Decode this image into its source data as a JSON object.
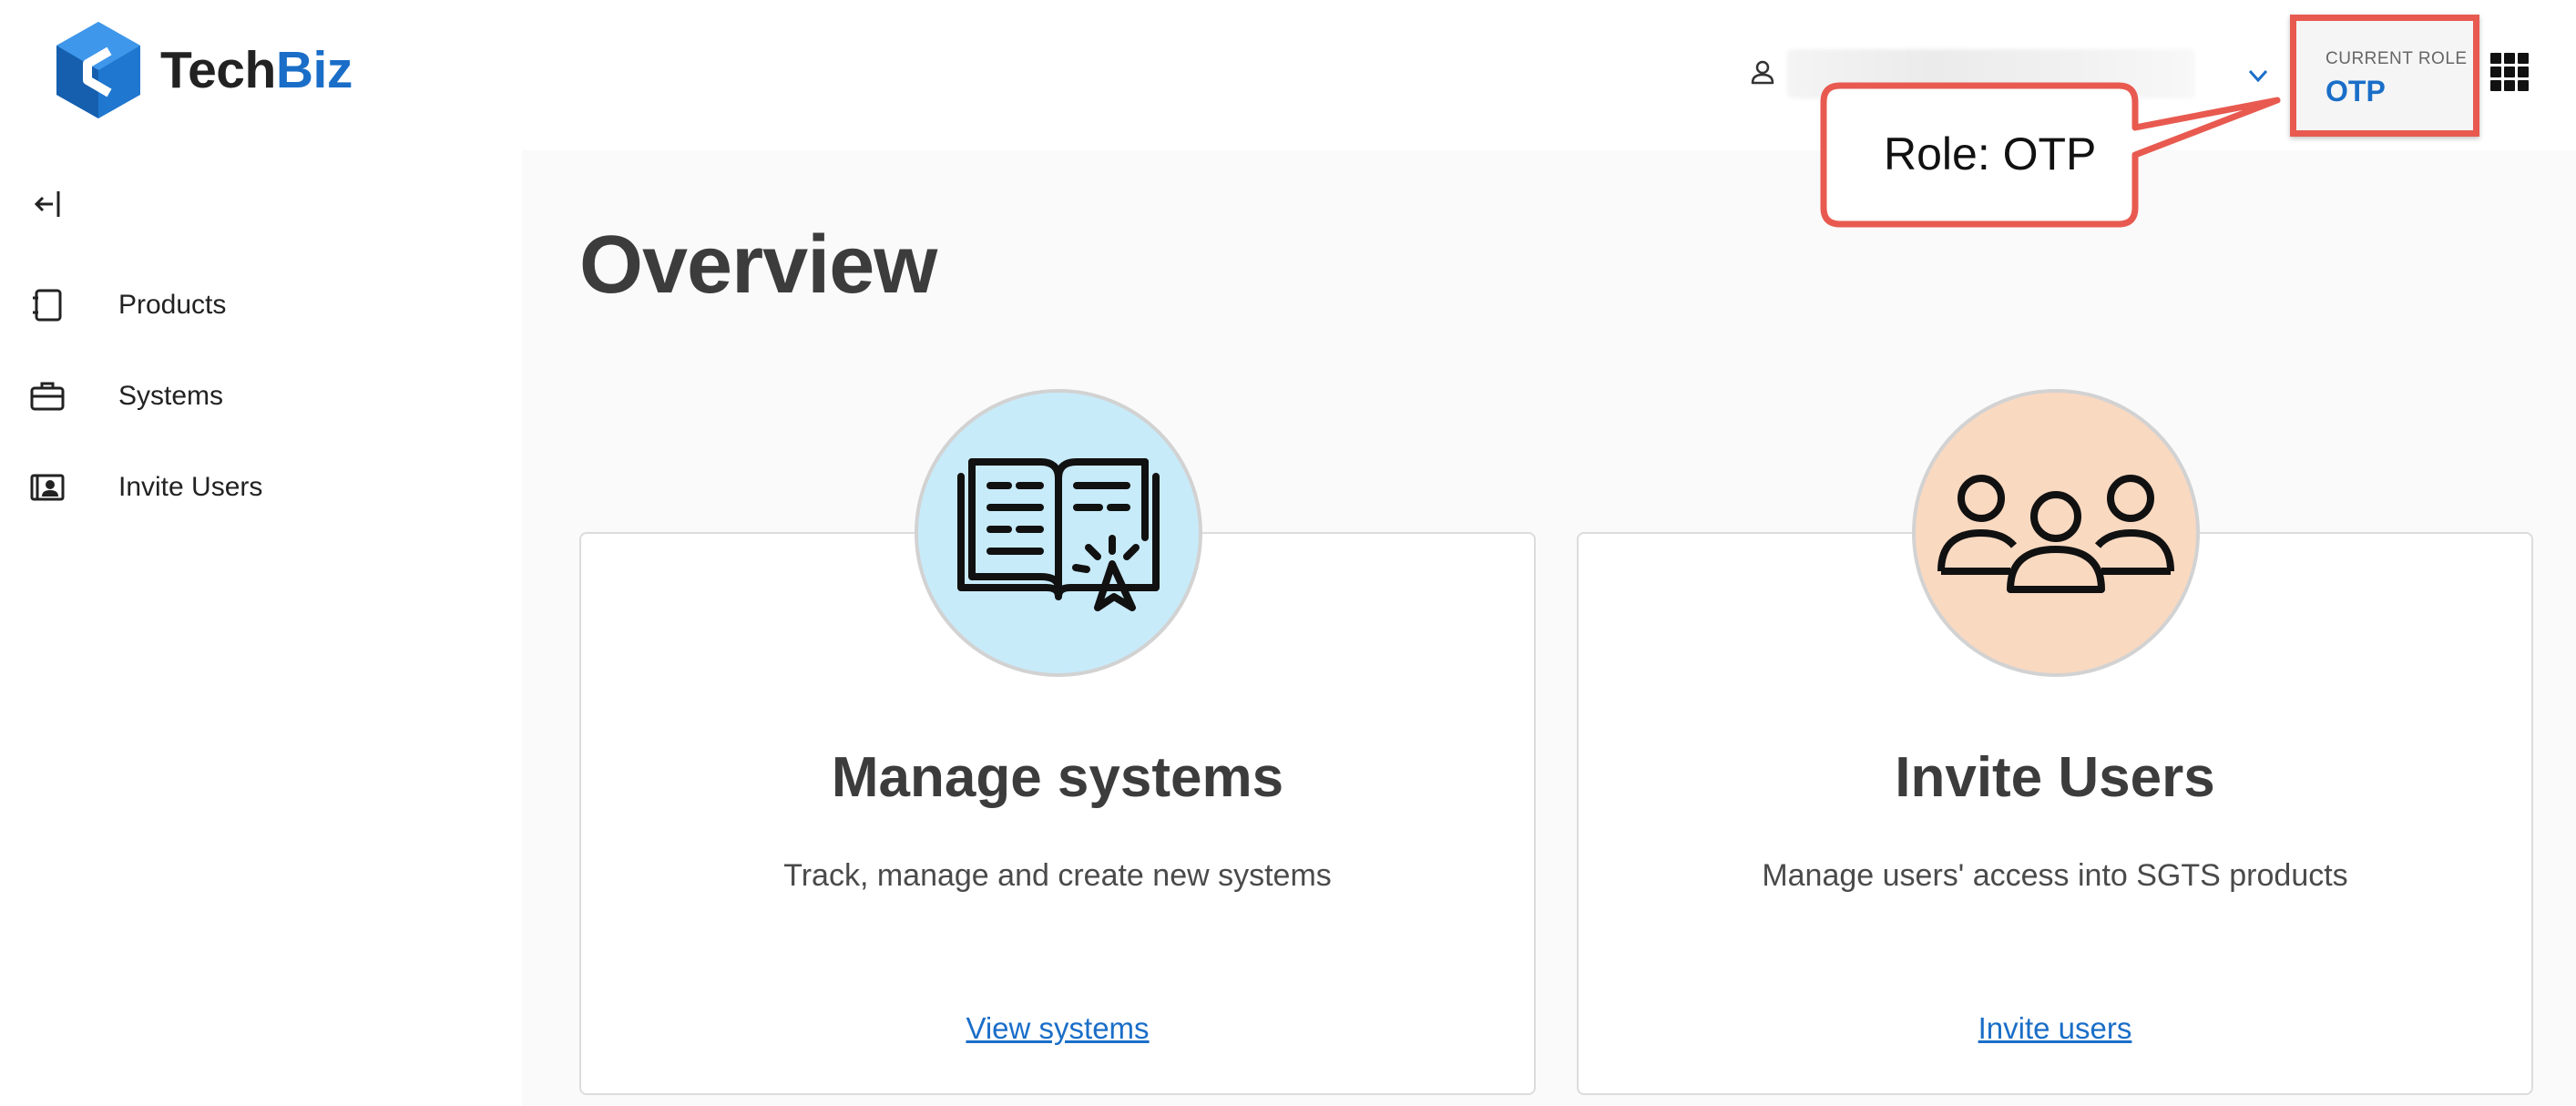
{
  "header": {
    "logo": {
      "part1": "Tech",
      "part2": "Biz"
    },
    "current_role": {
      "label": "CURRENT ROLE",
      "value": "OTP"
    }
  },
  "callout": {
    "text": "Role: OTP"
  },
  "sidebar": {
    "items": [
      {
        "label": "Products",
        "icon": "notebook-icon"
      },
      {
        "label": "Systems",
        "icon": "briefcase-icon"
      },
      {
        "label": "Invite Users",
        "icon": "contact-card-icon"
      }
    ]
  },
  "main": {
    "title": "Overview",
    "cards": [
      {
        "title": "Manage systems",
        "description": "Track, manage and create new systems",
        "link": "View systems",
        "icon": "book-cursor-icon",
        "icon_bg": "#c8ebfa"
      },
      {
        "title": "Invite Users",
        "description": "Manage users' access into SGTS products",
        "link": "Invite users",
        "icon": "users-group-icon",
        "icon_bg": "#fad9c1"
      }
    ]
  },
  "colors": {
    "brand_blue": "#1a6ec8",
    "highlight_red": "#e85a50",
    "main_bg": "#fafafa"
  }
}
